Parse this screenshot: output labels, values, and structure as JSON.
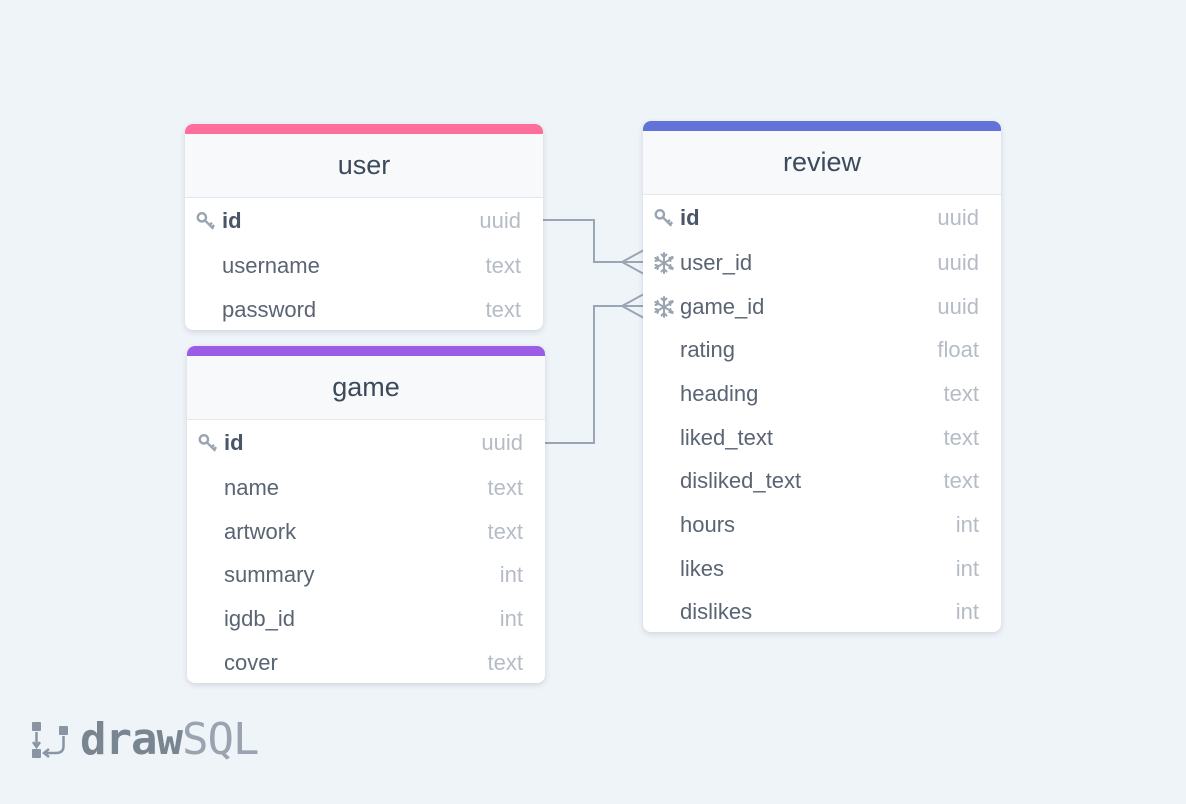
{
  "tables": {
    "user": {
      "name": "user",
      "accent": "#fd6f9a",
      "columns": [
        {
          "name": "id",
          "type": "uuid",
          "key": "primary"
        },
        {
          "name": "username",
          "type": "text"
        },
        {
          "name": "password",
          "type": "text"
        }
      ]
    },
    "game": {
      "name": "game",
      "accent": "#9b5de5",
      "columns": [
        {
          "name": "id",
          "type": "uuid",
          "key": "primary"
        },
        {
          "name": "name",
          "type": "text"
        },
        {
          "name": "artwork",
          "type": "text"
        },
        {
          "name": "summary",
          "type": "int"
        },
        {
          "name": "igdb_id",
          "type": "int"
        },
        {
          "name": "cover",
          "type": "text"
        }
      ]
    },
    "review": {
      "name": "review",
      "accent": "#6272d9",
      "columns": [
        {
          "name": "id",
          "type": "uuid",
          "key": "primary"
        },
        {
          "name": "user_id",
          "type": "uuid",
          "key": "foreign"
        },
        {
          "name": "game_id",
          "type": "uuid",
          "key": "foreign"
        },
        {
          "name": "rating",
          "type": "float"
        },
        {
          "name": "heading",
          "type": "text"
        },
        {
          "name": "liked_text",
          "type": "text"
        },
        {
          "name": "disliked_text",
          "type": "text"
        },
        {
          "name": "hours",
          "type": "int"
        },
        {
          "name": "likes",
          "type": "int"
        },
        {
          "name": "dislikes",
          "type": "int"
        }
      ]
    }
  },
  "relations": [
    {
      "from": "user.id",
      "to": "review.user_id",
      "cardinality": "one-to-many"
    },
    {
      "from": "game.id",
      "to": "review.game_id",
      "cardinality": "one-to-many"
    }
  ],
  "icons": {
    "primary": "key-icon",
    "foreign": "snowflake-icon"
  },
  "branding": {
    "draw": "draw",
    "sql": "SQL"
  }
}
